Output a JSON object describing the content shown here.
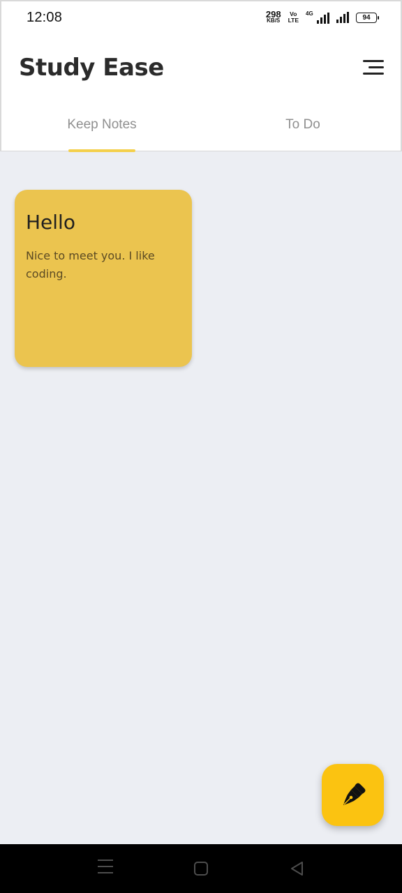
{
  "status_bar": {
    "time": "12:08",
    "net_speed_value": "298",
    "net_speed_unit": "KB/S",
    "volte_top": "Vo",
    "volte_bottom": "LTE",
    "network_type": "4G",
    "battery": "94"
  },
  "app_bar": {
    "title": "Study Ease"
  },
  "tabs": [
    {
      "label": "Keep Notes",
      "selected": true
    },
    {
      "label": "To Do",
      "selected": false
    }
  ],
  "notes": [
    {
      "title": "Hello",
      "body": "Nice to meet you. I like coding."
    }
  ],
  "colors": {
    "accent": "#F4D04B",
    "note_card": "#EBC44F",
    "fab": "#FBC311",
    "background": "#ECEEF3"
  },
  "icons": {
    "menu": "hamburger-menu-icon",
    "fab": "fountain-pen-icon"
  }
}
